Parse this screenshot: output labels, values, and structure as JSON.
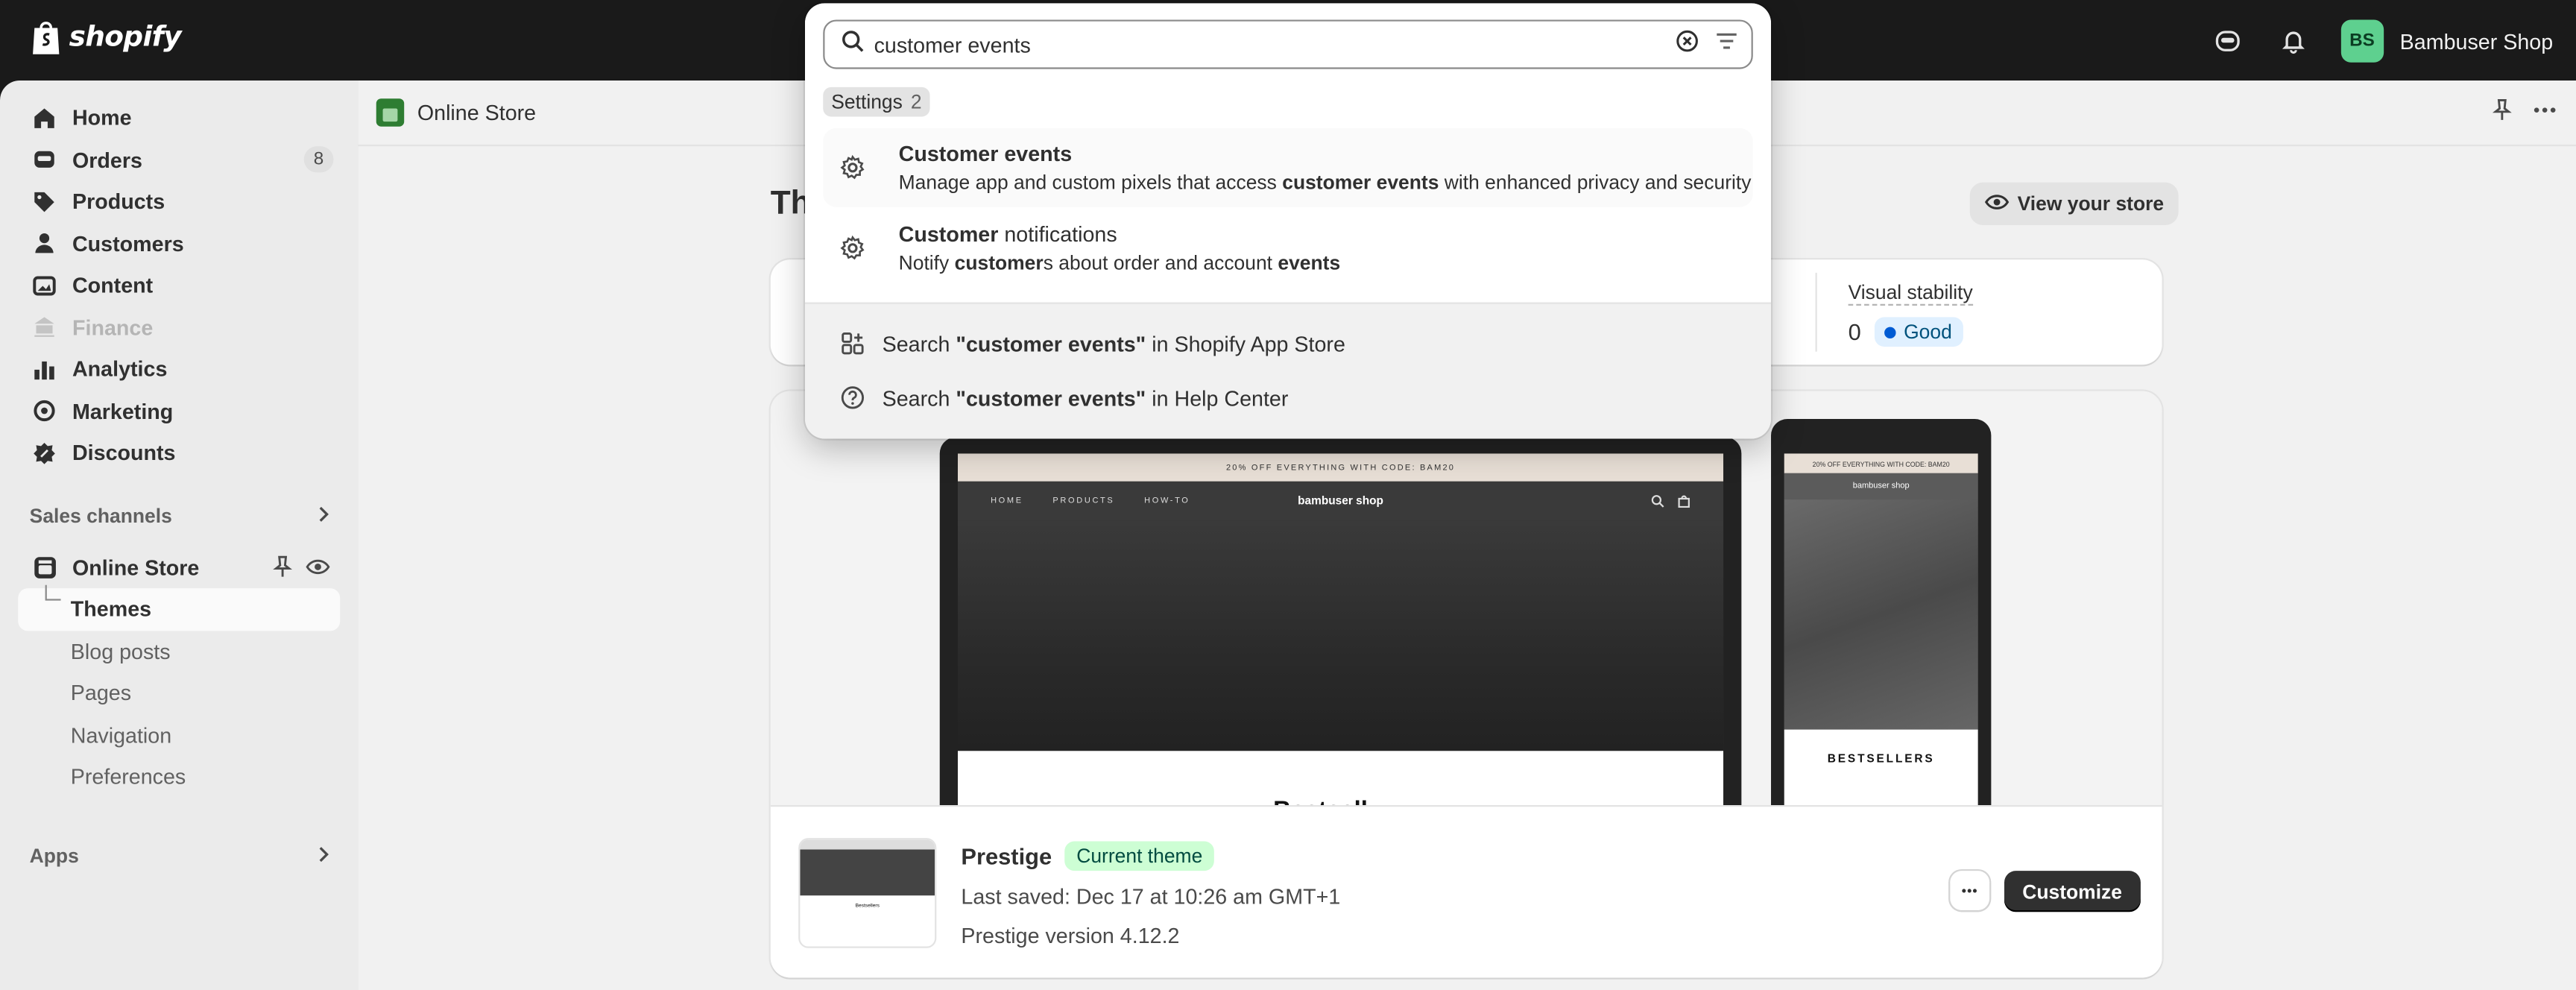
{
  "topbar": {
    "brand": "shopify",
    "shop_initials": "BS",
    "shop_name": "Bambuser Shop"
  },
  "sidebar": {
    "items": [
      {
        "label": "Home",
        "icon": "home-icon"
      },
      {
        "label": "Orders",
        "icon": "orders-icon",
        "badge": "8"
      },
      {
        "label": "Products",
        "icon": "tag-icon"
      },
      {
        "label": "Customers",
        "icon": "person-icon"
      },
      {
        "label": "Content",
        "icon": "content-icon"
      },
      {
        "label": "Finance",
        "icon": "bank-icon"
      },
      {
        "label": "Analytics",
        "icon": "chart-icon"
      },
      {
        "label": "Marketing",
        "icon": "target-icon"
      },
      {
        "label": "Discounts",
        "icon": "discount-icon"
      }
    ],
    "sales_channels_label": "Sales channels",
    "online_store_label": "Online Store",
    "sub_items": [
      "Themes",
      "Blog posts",
      "Pages",
      "Navigation",
      "Preferences"
    ],
    "apps_label": "Apps"
  },
  "subheader": {
    "title": "Online Store"
  },
  "page": {
    "title": "Th",
    "view_store": "View your store",
    "metric_label": "Visual stability",
    "metric_value": "0",
    "metric_status": "Good"
  },
  "preview": {
    "promo": "20% OFF EVERYTHING WITH CODE: BAM20",
    "nav_links": [
      "HOME",
      "PRODUCTS",
      "HOW-TO"
    ],
    "brand": "bambuser shop",
    "hero_text": "Bestsell",
    "mobile_section": "BESTSELLERS",
    "thumb_text": "Bestsellers"
  },
  "theme": {
    "name": "Prestige",
    "badge": "Current theme",
    "last_saved": "Last saved: Dec 17 at 10:26 am GMT+1",
    "version": "Prestige version 4.12.2",
    "more": "•••",
    "customize": "Customize"
  },
  "search": {
    "query": "customer events",
    "filter_label": "Settings",
    "filter_count": "2",
    "results": [
      {
        "title_bold": "Customer events",
        "title_rest": "",
        "desc_parts": [
          "Manage app and custom pixels that access ",
          "customer events",
          " with enhanced privacy and security"
        ]
      },
      {
        "title_bold": "Customer",
        "title_rest": " notifications",
        "desc_parts": [
          "Notify ",
          "customer",
          "s about order and account ",
          "events"
        ]
      }
    ],
    "app_store": {
      "pre": "Search ",
      "term": "\"customer events\"",
      "post": " in Shopify App Store"
    },
    "help_center": {
      "pre": "Search ",
      "term": "\"customer events\"",
      "post": " in Help Center"
    }
  }
}
